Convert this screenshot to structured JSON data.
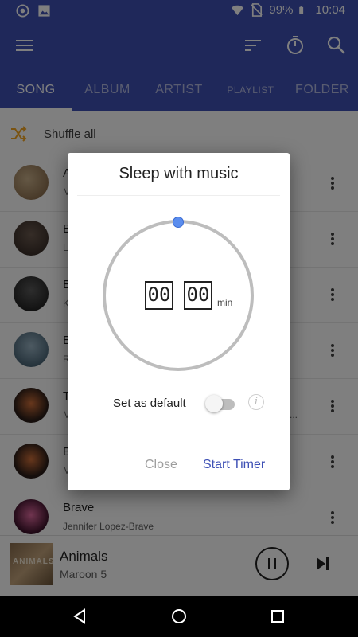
{
  "status_bar": {
    "battery": "99%",
    "time": "10:04",
    "icons": [
      "record-icon",
      "image-icon",
      "wifi-icon",
      "no-sim-icon",
      "battery-icon"
    ]
  },
  "app_bar": {
    "icons": [
      "menu-icon",
      "sort-icon",
      "sleep-timer-icon",
      "search-icon"
    ]
  },
  "tabs": [
    {
      "label": "SONG",
      "active": true
    },
    {
      "label": "ALBUM",
      "active": false
    },
    {
      "label": "ARTIST",
      "active": false
    },
    {
      "label": "PLAYLIST",
      "active": false
    },
    {
      "label": "FOLDER",
      "active": false
    }
  ],
  "shuffle": {
    "label": "Shuffle all",
    "icon": "shuffle-icon"
  },
  "songs": [
    {
      "title": "A",
      "subtitle": "M"
    },
    {
      "title": "B",
      "subtitle": "L"
    },
    {
      "title": "B",
      "subtitle": "K"
    },
    {
      "title": "B",
      "subtitle": "R"
    },
    {
      "title": "T",
      "subtitle": "M",
      "trail": "..."
    },
    {
      "title": "B",
      "subtitle": "M"
    },
    {
      "title": "Brave",
      "subtitle": "Jennifer Lopez-Brave"
    }
  ],
  "now_playing": {
    "art_text": "ANIMALS",
    "title": "Animals",
    "artist": "Maroon 5"
  },
  "dialog": {
    "title": "Sleep with music",
    "hours": "00",
    "minutes": "00",
    "unit": "min",
    "default_label": "Set as default",
    "default_on": false,
    "info_glyph": "i",
    "close_label": "Close",
    "start_label": "Start Timer"
  },
  "colors": {
    "primary": "#3f51b5",
    "knob": "#5b8dee",
    "shuffle_icon": "#f5a623"
  }
}
